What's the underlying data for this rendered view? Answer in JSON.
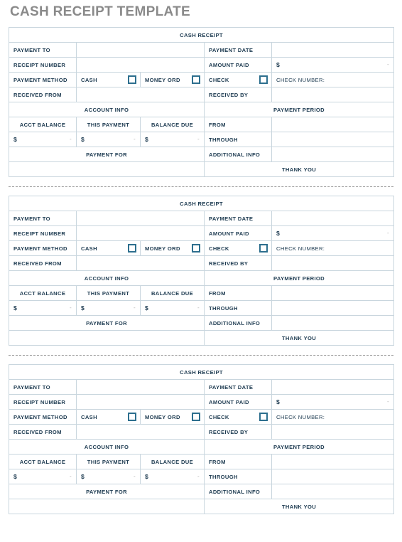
{
  "page": {
    "title": "CASH RECEIPT TEMPLATE",
    "title_color": "#8a8a8a"
  },
  "colors": {
    "header_bar": "#2a4759",
    "label_cell": "#a8cadd",
    "section_cell": "#b9d6e6",
    "thanks_cell": "#d6e8f1",
    "checkbox_border": "#2d6f8e",
    "text": "#1f3c52",
    "grid_line": "#c9d6de"
  },
  "receipt": {
    "header": "CASH RECEIPT",
    "labels": {
      "payment_to": "PAYMENT TO",
      "receipt_number": "RECEIPT NUMBER",
      "payment_method": "PAYMENT METHOD",
      "received_from": "RECEIVED FROM",
      "payment_date": "PAYMENT DATE",
      "amount_paid": "AMOUNT PAID",
      "check_number": "CHECK NUMBER:",
      "received_by": "RECEIVED BY",
      "account_info": "ACCOUNT INFO",
      "payment_period": "PAYMENT PERIOD",
      "acct_balance": "ACCT BALANCE",
      "this_payment": "THIS PAYMENT",
      "balance_due": "BALANCE DUE",
      "from": "FROM",
      "through": "THROUGH",
      "payment_for": "PAYMENT FOR",
      "additional_info": "ADDITIONAL INFO",
      "thank_you": "THANK YOU"
    },
    "payment_methods": [
      {
        "label": "CASH",
        "checked": false
      },
      {
        "label": "MONEY ORD",
        "checked": false
      },
      {
        "label": "CHECK",
        "checked": false
      }
    ],
    "money": {
      "symbol": "$",
      "placeholder_dash": "-"
    },
    "values": {
      "payment_to": "",
      "receipt_number": "",
      "received_from": "",
      "payment_date": "",
      "check_number": "",
      "received_by": "",
      "acct_balance": "",
      "this_payment": "",
      "balance_due": "",
      "amount_paid": "",
      "from": "",
      "through": "",
      "additional_info": "",
      "payment_for": ""
    }
  },
  "receipt_count": 3
}
